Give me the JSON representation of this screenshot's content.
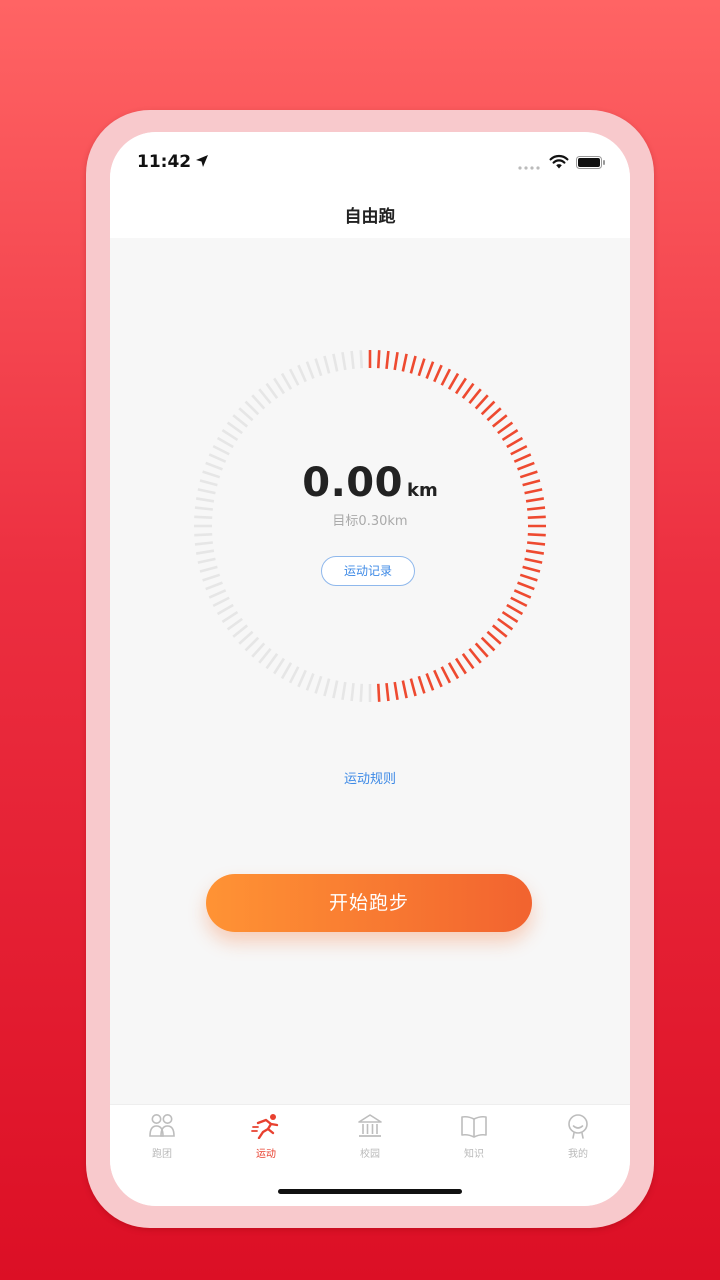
{
  "status_bar": {
    "time": "11:42",
    "icons": [
      "location-arrow-icon",
      "signal-dots-icon",
      "wifi-icon",
      "battery-icon"
    ]
  },
  "nav": {
    "title": "自由跑"
  },
  "progress": {
    "distance": "0.00",
    "unit": "km",
    "goal_text": "目标0.30km",
    "progress_fraction": 0.5,
    "active_color": "#ee4a30",
    "inactive_color": "#e6e6e6"
  },
  "record_button": {
    "label": "运动记录"
  },
  "rules_link": {
    "label": "运动规则"
  },
  "start_button": {
    "label": "开始跑步"
  },
  "tabs": [
    {
      "label": "跑团",
      "icon": "group-icon",
      "active": false
    },
    {
      "label": "运动",
      "icon": "running-icon",
      "active": true
    },
    {
      "label": "校园",
      "icon": "campus-building-icon",
      "active": false
    },
    {
      "label": "知识",
      "icon": "book-icon",
      "active": false
    },
    {
      "label": "我的",
      "icon": "profile-icon",
      "active": false
    }
  ],
  "colors": {
    "accent": "#e8402f",
    "link": "#3e8ae6",
    "background_top": "#ff6464",
    "background_bottom": "#dc0f25"
  }
}
